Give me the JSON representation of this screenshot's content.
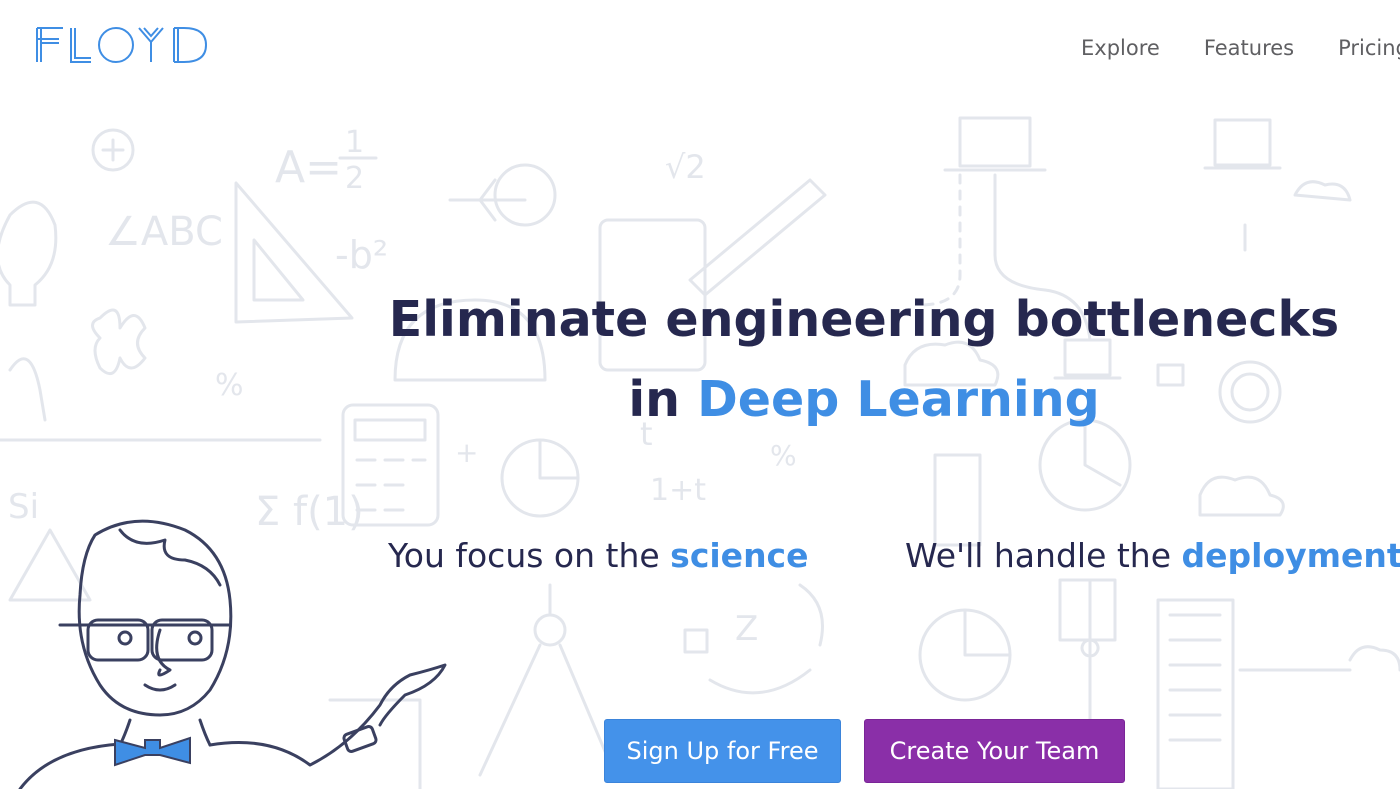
{
  "brand": {
    "name": "FLOYD",
    "color": "#3f8ee4"
  },
  "nav": {
    "items": [
      {
        "label": "Explore"
      },
      {
        "label": "Features"
      },
      {
        "label": "Pricing"
      }
    ]
  },
  "hero": {
    "headline_line1": "Eliminate engineering bottlenecks",
    "headline_prefix": "in ",
    "headline_accent": "Deep Learning",
    "tagline_left_prefix": "You focus on the ",
    "tagline_left_accent": "science",
    "tagline_right_prefix": "We'll handle the ",
    "tagline_right_accent": "deployment"
  },
  "cta": {
    "signup_label": "Sign Up for Free",
    "team_label": "Create Your Team"
  },
  "colors": {
    "accent": "#3f8ee4",
    "text_dark": "#26284f",
    "signup_bg": "#4492ea",
    "team_bg": "#8a2fa8"
  },
  "background_doodles": {
    "formulas": [
      "A = 1/2",
      "∠ABC",
      "-b²",
      "%",
      "√2",
      "t/2",
      "1 + t",
      "f(1)",
      "Si",
      "Σ",
      "Z"
    ]
  },
  "mascot": {
    "name": "scientist-illustration"
  }
}
